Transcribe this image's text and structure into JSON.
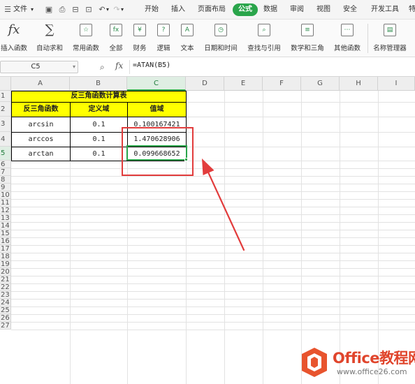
{
  "menubar": {
    "file_label": "文件",
    "tabs": [
      "开始",
      "插入",
      "页面布局",
      "公式",
      "数据",
      "审阅",
      "视图",
      "安全",
      "开发工具",
      "特"
    ],
    "active_tab": "公式"
  },
  "ribbon": {
    "buttons": [
      "插入函数",
      "自动求和",
      "常用函数",
      "全部",
      "财务",
      "逻辑",
      "文本",
      "日期和时间",
      "查找与引用",
      "数学和三角",
      "其他函数",
      "名称管理器"
    ],
    "icon_glyphs": [
      "fx",
      "∑",
      "☆",
      "fx",
      "¥",
      "?",
      "A",
      "◷",
      "⌕",
      "≡",
      "⋯",
      "▤"
    ]
  },
  "formula_bar": {
    "cell_ref": "C5",
    "fx_label": "fx",
    "formula": "=ATAN(B5)"
  },
  "grid": {
    "columns": [
      "A",
      "B",
      "C",
      "D",
      "E",
      "F",
      "G",
      "H",
      "I"
    ],
    "rows": [
      "1",
      "2",
      "3",
      "4",
      "5",
      "6",
      "7",
      "8",
      "9",
      "10",
      "11",
      "12",
      "13",
      "14",
      "15",
      "16",
      "17",
      "18",
      "19",
      "20",
      "21",
      "22",
      "23",
      "24",
      "25",
      "26",
      "27"
    ],
    "selected_cell": "C5"
  },
  "table": {
    "title": "反三角函数计算表",
    "headers": [
      "反三角函数",
      "定义域",
      "值域"
    ],
    "rows": [
      [
        "arcsin",
        "0.1",
        "0.100167421"
      ],
      [
        "arccos",
        "0.1",
        "1.470628906"
      ],
      [
        "arctan",
        "0.1",
        "0.099668652"
      ]
    ]
  },
  "watermark": {
    "title": "Office教程网",
    "url": "www.office26.com"
  },
  "colors": {
    "accent_green": "#2aa54b",
    "header_yellow": "#ffff00",
    "annotation_red": "#e23c3c",
    "watermark_orange": "#e0452c"
  }
}
